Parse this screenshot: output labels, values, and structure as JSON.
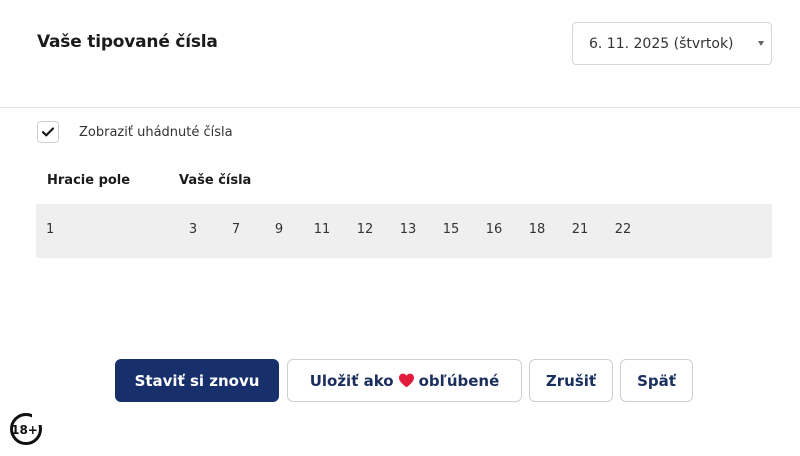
{
  "header": {
    "title": "Vaše tipované čísla",
    "date_select_value": "6. 11. 2025 (štvrtok)"
  },
  "options": {
    "show_guessed_label": "Zobraziť uhádnuté čísla",
    "show_guessed_checked": true
  },
  "table": {
    "columns": [
      "Hracie pole",
      "Vaše čísla"
    ],
    "rows": [
      {
        "field": "1",
        "numbers": [
          "3",
          "7",
          "9",
          "11",
          "12",
          "13",
          "15",
          "16",
          "18",
          "21",
          "22"
        ]
      }
    ]
  },
  "actions": {
    "bet_again": "Staviť si znovu",
    "save_fav_prefix": "Uložiť ako",
    "save_fav_suffix": "obľúbené",
    "cancel": "Zrušiť",
    "back": "Späť"
  },
  "footer": {
    "age_badge": "18+"
  },
  "colors": {
    "primary": "#17306b",
    "heart": "#e21b3c",
    "row_bg": "#efefef"
  },
  "icons": [
    "check-icon",
    "chevron-down-icon",
    "heart-icon",
    "age-18-icon"
  ]
}
